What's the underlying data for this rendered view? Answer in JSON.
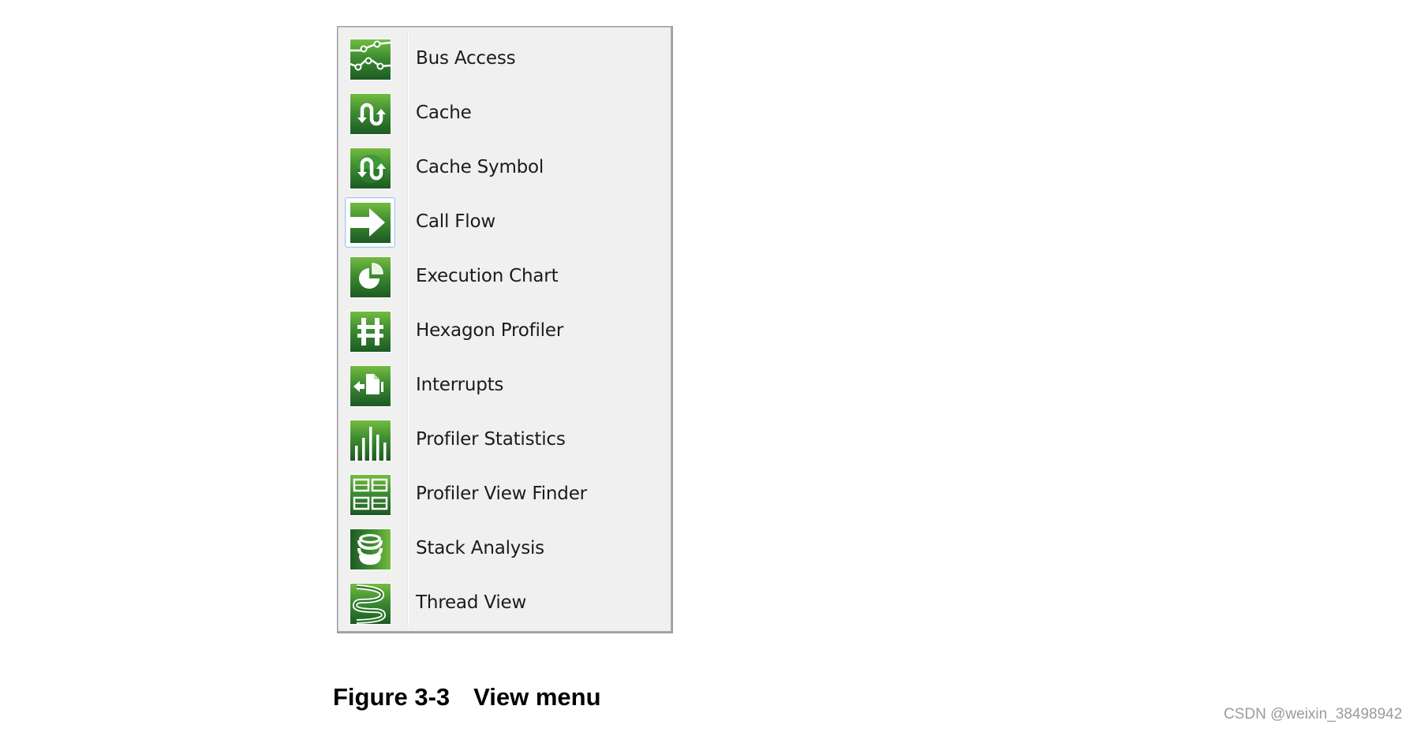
{
  "menu": {
    "title": "View menu",
    "focused_item": "Call Flow",
    "items": [
      {
        "label": "Bus Access",
        "icon": "bus-access-icon"
      },
      {
        "label": "Cache",
        "icon": "cache-icon"
      },
      {
        "label": "Cache Symbol",
        "icon": "cache-symbol-icon"
      },
      {
        "label": "Call Flow",
        "icon": "call-flow-icon"
      },
      {
        "label": "Execution Chart",
        "icon": "execution-chart-icon"
      },
      {
        "label": "Hexagon Profiler",
        "icon": "hexagon-profiler-icon"
      },
      {
        "label": "Interrupts",
        "icon": "interrupts-icon"
      },
      {
        "label": "Profiler Statistics",
        "icon": "profiler-statistics-icon"
      },
      {
        "label": "Profiler View Finder",
        "icon": "profiler-view-finder-icon"
      },
      {
        "label": "Stack Analysis",
        "icon": "stack-analysis-icon"
      },
      {
        "label": "Thread View",
        "icon": "thread-view-icon"
      }
    ]
  },
  "caption": {
    "figure_number": "Figure 3-3",
    "title": "View menu"
  },
  "watermark": "CSDN @weixin_38498942",
  "colors": {
    "icon_green_light": "#74bb3f",
    "icon_green_dark": "#1d5a24",
    "menu_background": "#f0f0f0",
    "focus_border": "#a9c6ee"
  }
}
